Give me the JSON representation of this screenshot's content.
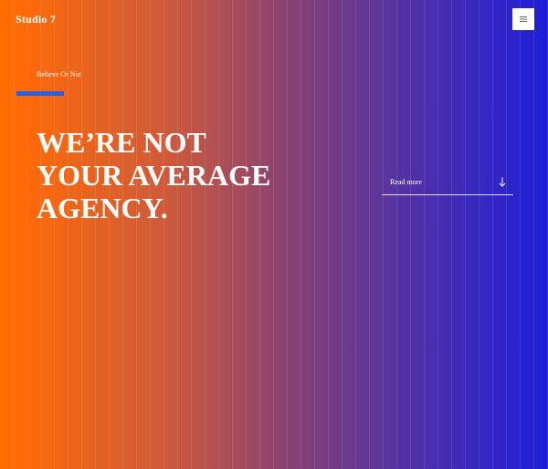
{
  "header": {
    "logo_text": "Studio 7",
    "menu_icon": "hamburger-icon"
  },
  "hero": {
    "eyebrow": "Believe Or Not",
    "headline_lines": [
      "WE’RE NOT",
      "YOUR AVERAGE",
      "AGENCY."
    ],
    "cta_label": "Read more",
    "cta_icon": "arrow-down-icon"
  },
  "colors": {
    "gradient_start": "#ff6d00",
    "gradient_end": "#1e1ed8",
    "accent_bar": "#2d5fe0",
    "text": "#ffffff"
  }
}
